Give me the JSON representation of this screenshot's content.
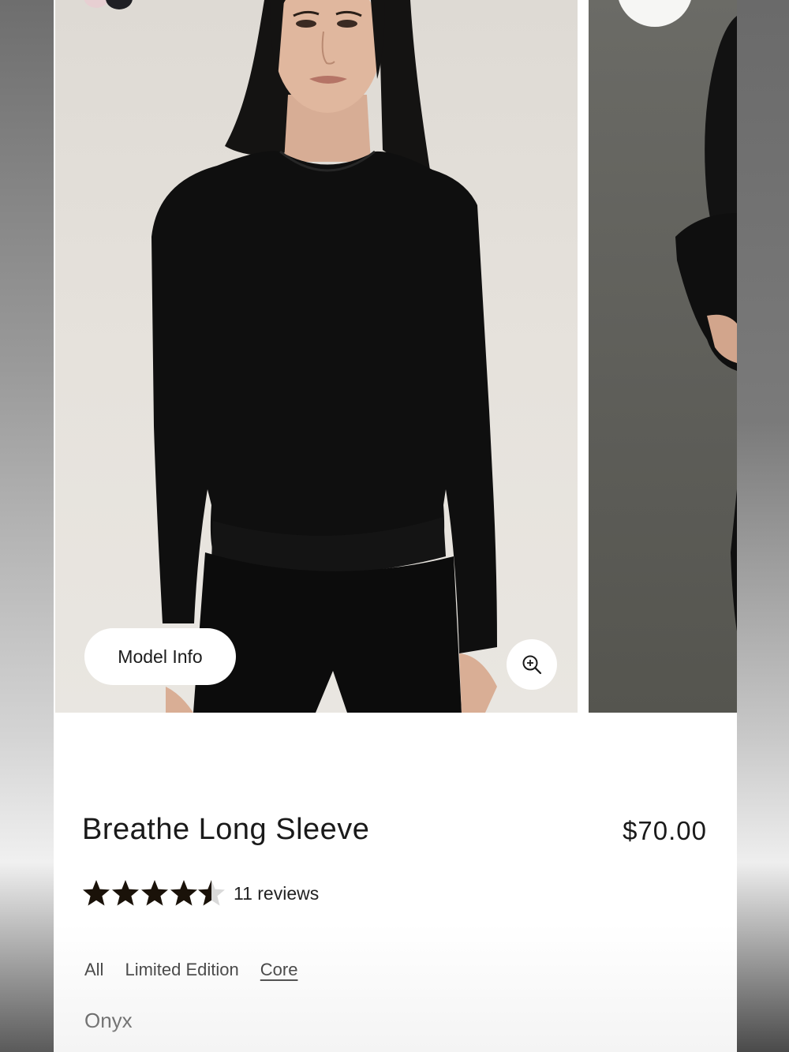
{
  "carousel": {
    "model_info_label": "Model Info",
    "zoom_icon": "zoom-in-icon"
  },
  "product": {
    "title": "Breathe Long Sleeve",
    "price": "$70.00",
    "rating": 4.5,
    "rating_max": 5,
    "reviews_label": "11 reviews"
  },
  "filters": {
    "tabs": [
      {
        "label": "All",
        "active": false
      },
      {
        "label": "Limited Edition",
        "active": false
      },
      {
        "label": "Core",
        "active": true
      }
    ]
  },
  "color": {
    "selected_name": "Onyx"
  },
  "colors": {
    "text": "#1a1a1a",
    "garment": "#0f0f0f",
    "star": "#1a1209"
  }
}
